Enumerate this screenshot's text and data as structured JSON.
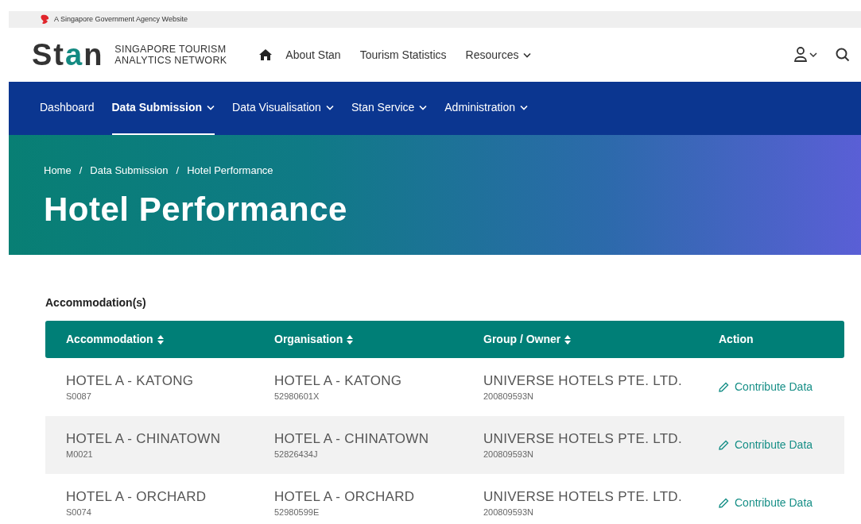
{
  "gov_banner": {
    "text": "A Singapore Government Agency Website"
  },
  "logo": {
    "parts": [
      {
        "text": "St",
        "color": "#333333"
      },
      {
        "text": "a",
        "color": "#138a82"
      },
      {
        "text": "n",
        "color": "#333333"
      }
    ],
    "tagline": [
      "SINGAPORE TOURISM",
      "ANALYTICS NETWORK"
    ]
  },
  "top_nav": [
    {
      "label": "About Stan",
      "has_menu": false
    },
    {
      "label": "Tourism Statistics",
      "has_menu": false
    },
    {
      "label": "Resources",
      "has_menu": true
    }
  ],
  "main_nav": [
    {
      "label": "Dashboard",
      "has_menu": false,
      "selected": false
    },
    {
      "label": "Data Submission",
      "has_menu": true,
      "selected": true
    },
    {
      "label": "Data Visualisation",
      "has_menu": true,
      "selected": false
    },
    {
      "label": "Stan Service",
      "has_menu": true,
      "selected": false
    },
    {
      "label": "Administration",
      "has_menu": true,
      "selected": false
    }
  ],
  "breadcrumb": [
    "Home",
    "Data Submission",
    "Hotel Performance"
  ],
  "breadcrumb_separator": "/",
  "page_title": "Hotel Performance",
  "section_title": "Accommodation(s)",
  "table": {
    "columns": [
      {
        "label": "Accommodation",
        "sortable": true
      },
      {
        "label": "Organisation",
        "sortable": true
      },
      {
        "label": "Group / Owner",
        "sortable": true
      },
      {
        "label": "Action",
        "sortable": false
      }
    ],
    "rows": [
      {
        "accommodation": "HOTEL A - KATONG",
        "accommodation_code": "S0087",
        "organisation": "HOTEL A - KATONG",
        "organisation_code": "52980601X",
        "owner": "UNIVERSE HOTELS PTE. LTD.",
        "owner_code": "200809593N",
        "action": "Contribute Data"
      },
      {
        "accommodation": "HOTEL A - CHINATOWN",
        "accommodation_code": "M0021",
        "organisation": "HOTEL A - CHINATOWN",
        "organisation_code": "52826434J",
        "owner": "UNIVERSE HOTELS PTE. LTD.",
        "owner_code": "200809593N",
        "action": "Contribute Data"
      },
      {
        "accommodation": "HOTEL A - ORCHARD",
        "accommodation_code": "S0074",
        "organisation": "HOTEL A - ORCHARD",
        "organisation_code": "52980599E",
        "owner": "UNIVERSE HOTELS PTE. LTD.",
        "owner_code": "200809593N",
        "action": "Contribute Data"
      }
    ]
  }
}
